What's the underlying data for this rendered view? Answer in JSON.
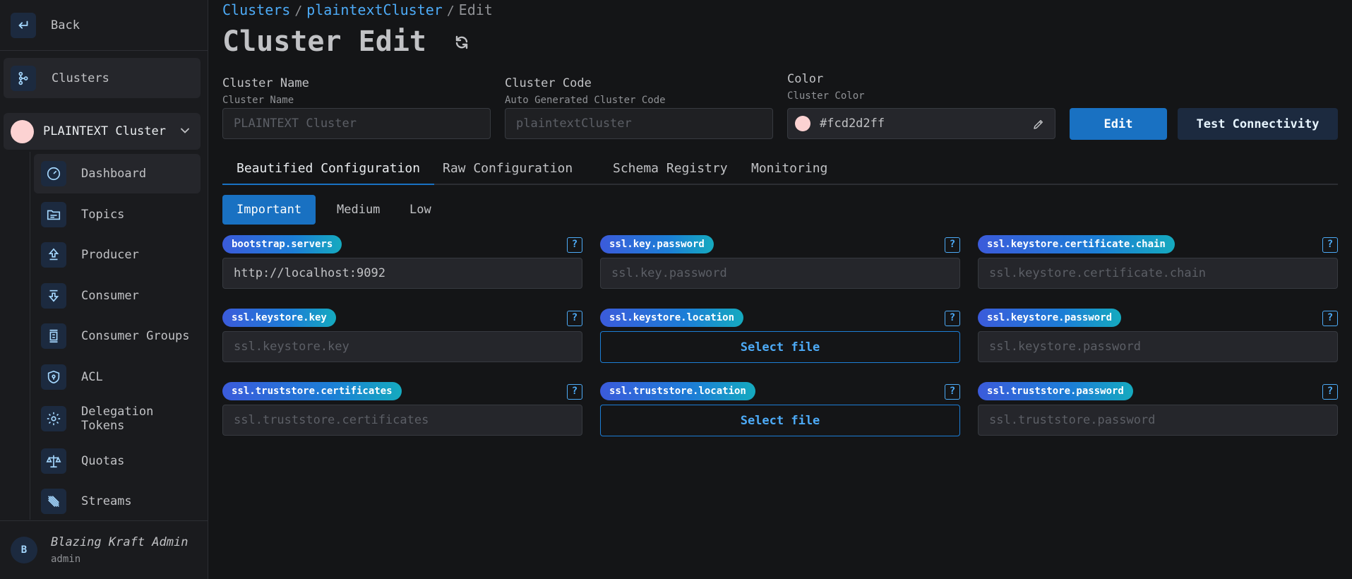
{
  "sidebar": {
    "back_label": "Back",
    "clusters_label": "Clusters",
    "cluster_name": "PLAINTEXT Cluster",
    "cluster_color": "#fcd2d2",
    "items": [
      {
        "label": "Dashboard",
        "icon": "gauge-icon"
      },
      {
        "label": "Topics",
        "icon": "folder-icon"
      },
      {
        "label": "Producer",
        "icon": "upload-icon"
      },
      {
        "label": "Consumer",
        "icon": "download-icon"
      },
      {
        "label": "Consumer Groups",
        "icon": "group-icon"
      },
      {
        "label": "ACL",
        "icon": "shield-icon"
      },
      {
        "label": "Delegation Tokens",
        "icon": "gear-icon"
      },
      {
        "label": "Quotas",
        "icon": "scale-icon"
      },
      {
        "label": "Streams",
        "icon": "streams-icon"
      }
    ],
    "user": {
      "initial": "B",
      "name": "Blazing Kraft Admin",
      "role": "admin"
    }
  },
  "breadcrumb": {
    "root": "Clusters",
    "cluster": "plaintextCluster",
    "current": "Edit",
    "separator": "/"
  },
  "page_title": "Cluster Edit",
  "form": {
    "name": {
      "label": "Cluster Name",
      "description": "Cluster Name",
      "placeholder": "PLAINTEXT Cluster"
    },
    "code": {
      "label": "Cluster Code",
      "description": "Auto Generated Cluster Code",
      "placeholder": "plaintextCluster"
    },
    "color": {
      "label": "Color",
      "description": "Cluster Color",
      "value": "#fcd2d2ff"
    },
    "edit_button": "Edit",
    "test_button": "Test Connectivity"
  },
  "tabs": [
    "Beautified Configuration",
    "Raw Configuration",
    "Schema Registry",
    "Monitoring"
  ],
  "importance": [
    "Important",
    "Medium",
    "Low"
  ],
  "configs": [
    {
      "key": "bootstrap.servers",
      "value": "http://localhost:9092",
      "placeholder": "",
      "type": "text"
    },
    {
      "key": "ssl.key.password",
      "value": "",
      "placeholder": "ssl.key.password",
      "type": "text"
    },
    {
      "key": "ssl.keystore.certificate.chain",
      "value": "",
      "placeholder": "ssl.keystore.certificate.chain",
      "type": "text"
    },
    {
      "key": "ssl.keystore.key",
      "value": "",
      "placeholder": "ssl.keystore.key",
      "type": "text"
    },
    {
      "key": "ssl.keystore.location",
      "button": "Select file",
      "type": "file"
    },
    {
      "key": "ssl.keystore.password",
      "value": "",
      "placeholder": "ssl.keystore.password",
      "type": "text"
    },
    {
      "key": "ssl.truststore.certificates",
      "value": "",
      "placeholder": "ssl.truststore.certificates",
      "type": "text"
    },
    {
      "key": "ssl.truststore.location",
      "button": "Select file",
      "type": "file"
    },
    {
      "key": "ssl.truststore.password",
      "value": "",
      "placeholder": "ssl.truststore.password",
      "type": "text"
    }
  ],
  "help_glyph": "?",
  "colors": {
    "accent": "#1971c2",
    "background": "#141517",
    "sidebar": "#1a1b1e"
  }
}
